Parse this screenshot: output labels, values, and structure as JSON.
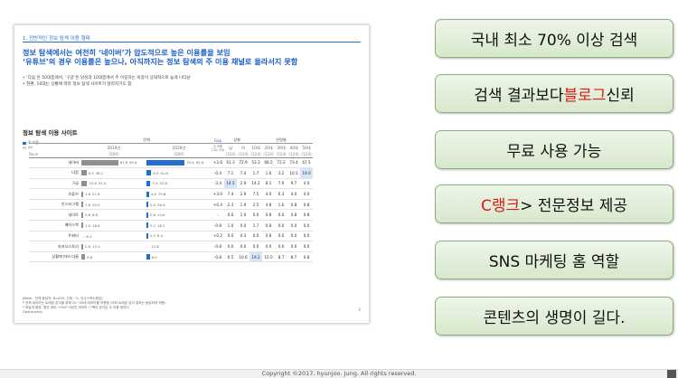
{
  "slide": {
    "section": "1. 전반적인 정보 탐색 이용 형태",
    "headline_1": "정보 탐색에서는 여전히 ‘네이버’가 압도적으로 높은 이용률을 보임",
    "headline_2": "‘유튜브’의 경우 이용률은 높으나, 아직까지는 정보 탐색의 주 이용 채널로 올라서지 못함",
    "bullet_1": "• ‘다음’은 50대층에서, ‘구글’은 남성과 10대층에서 주 이용하는 비중이 상대적으로 높게 나타남",
    "bullet_2": "• 현편, 10대는 상황에 따라 정보 탐색 사이트가 달라지기도 함",
    "chart_title": "정보 탐색 이용 사이트",
    "legend_main": "주 이용",
    "legend_all": "All",
    "notes_1": "[Base : 전체 응답자, N=620, 단위 : %, 단수+복수응답]",
    "notes_2": "* 전체 데이터는 트래킹 분석을 위해 20~50대 데이터를 적용함 (이하 트래킹 분석 결과는 동일하게 적용)",
    "notes_3": "* 하늘색 음영: 평균 대비 +5%P 이상인 데이터 / *벡터 분석은 주 이용 데이터",
    "notes_4": "Opensurvey",
    "page": "6",
    "header": {
      "overall": "전체",
      "gap": "Gap",
      "gender": "성별",
      "age": "연령별",
      "y2019": "2019년",
      "y2020": "2020년",
      "gap_sub": "주 이용 (’20-’19)",
      "male": "남",
      "female": "여",
      "a10": "10대",
      "a20": "20대",
      "a30": "30대",
      "a40": "40대",
      "a50": "50대",
      "base": "Base",
      "b2019": "(500)",
      "b2020": "(500)",
      "bmale": "(310)",
      "bfemale": "(310)",
      "b10": "(124)",
      "b20": "(124)",
      "b30": "(124)",
      "b40": "(124)",
      "b50": "(124)"
    },
    "rows": [
      {
        "site": "네이버",
        "m19": "67.8",
        "t19": "95.6",
        "m20": "70.4",
        "t20": "95.6",
        "gap": "+2.6",
        "male": "61.3",
        "female": "72.9",
        "a10": "53.3",
        "a20": "68.5",
        "a30": "72.2",
        "a40": "73.4",
        "a50": "67.5",
        "v19": 67.8,
        "v20": 70.4
      },
      {
        "site": "다음",
        "m19": "9.3",
        "t19": "38.2",
        "m20": "8.9",
        "t20": "41.8",
        "gap": "-0.4",
        "male": "7.1",
        "female": "7.4",
        "a10": "1.7",
        "a20": "1.6",
        "a30": "3.2",
        "a40": "10.5",
        "a50": "19.0",
        "v19": 9.3,
        "v20": 8.9
      },
      {
        "site": "구글",
        "m19": "10.8",
        "t19": "52.2",
        "m20": "7.4",
        "t20": "53.8",
        "gap": "-3.4",
        "male": "14.5",
        "female": "2.9",
        "a10": "14.2",
        "a20": "8.1",
        "a30": "7.9",
        "a40": "9.7",
        "a50": "4.0",
        "v19": 10.8,
        "v20": 7.4
      },
      {
        "site": "유튜브",
        "m19": "1.6",
        "t19": "57.6",
        "m20": "4.6",
        "t20": "70.6",
        "gap": "+3.0",
        "male": "7.4",
        "female": "2.9",
        "a10": "7.5",
        "a20": "4.0",
        "a30": "6.3",
        "a40": "4.0",
        "a50": "4.0",
        "v19": 1.6,
        "v20": 4.6
      },
      {
        "site": "인스타그램",
        "m19": "1.6",
        "t19": "30.0",
        "m20": "2.0",
        "t20": "36.4",
        "gap": "+0.4",
        "male": "2.3",
        "female": "1.9",
        "a10": "2.5",
        "a20": "4.8",
        "a30": "1.6",
        "a40": "0.8",
        "a50": "0.8",
        "v19": 1.6,
        "v20": 2.0
      },
      {
        "site": "네이트",
        "m19": "0.6",
        "t19": "8.8",
        "m20": "0.6",
        "t20": "10.6",
        "gap": "-",
        "male": "0.0",
        "female": "1.0",
        "a10": "0.0",
        "a20": "0.8",
        "a30": "0.0",
        "a40": "0.8",
        "a50": "0.8",
        "v19": 0.6,
        "v20": 0.6
      },
      {
        "site": "페이스북",
        "m19": "1.0",
        "t19": "18.6",
        "m20": "0.2",
        "t20": "18.2",
        "gap": "-0.8",
        "male": "1.0",
        "female": "0.0",
        "a10": "1.7",
        "a20": "0.8",
        "a30": "0.0",
        "a40": "0.0",
        "a50": "0.0",
        "v19": 1.0,
        "v20": 0.2
      },
      {
        "site": "트위터",
        "m19": "-",
        "t19": "8.4",
        "m20": "0.2",
        "t20": "8.4",
        "gap": "+0.2",
        "male": "0.0",
        "female": "0.3",
        "a10": "0.0",
        "a20": "0.8",
        "a30": "0.0",
        "a40": "0.0",
        "a50": "0.0",
        "v19": 0,
        "v20": 0.2
      },
      {
        "site": "카카오스토리",
        "m19": "0.8",
        "t19": "12.4",
        "m20": "-",
        "t20": "12.8",
        "gap": "-0.8",
        "male": "0.0",
        "female": "0.0",
        "a10": "0.0",
        "a20": "0.0",
        "a30": "0.0",
        "a40": "0.0",
        "a50": "0.0",
        "v19": 0.8,
        "v20": 0
      },
      {
        "site": "상황에 따라 다름",
        "m19": "6.8",
        "t19": "",
        "m20": "6.0",
        "t20": "",
        "gap": "-0.8",
        "male": "6.5",
        "female": "10.6",
        "a10": "19.2",
        "a20": "10.5",
        "a30": "8.7",
        "a40": "8.7",
        "a50": "0.8",
        "v19": 6.8,
        "v20": 6.0
      }
    ]
  },
  "boxes": [
    {
      "pre": "국내 최소 70% 이상 검색",
      "red": "",
      "post": ""
    },
    {
      "pre": "검색 결과보다 ",
      "red": "블로그",
      "post": " 신뢰"
    },
    {
      "pre": "무료 사용 가능",
      "red": "",
      "post": ""
    },
    {
      "pre": "",
      "red": "C랭크",
      "post": " > 전문정보 제공"
    },
    {
      "pre": "SNS 마케팅 홈 역할",
      "red": "",
      "post": ""
    },
    {
      "pre": "콘텐츠의 생명이 길다.",
      "red": "",
      "post": ""
    }
  ],
  "footer": "Copyright ©2017. hyunjoo. Jung. All rights reserved.",
  "colors": {
    "headline": "#1e5fc8",
    "bar2019": "#8f8f8f",
    "bar2020": "#1f6fd1",
    "box_text_accent": "#e01717",
    "box_fill": "#d7e8cc"
  }
}
